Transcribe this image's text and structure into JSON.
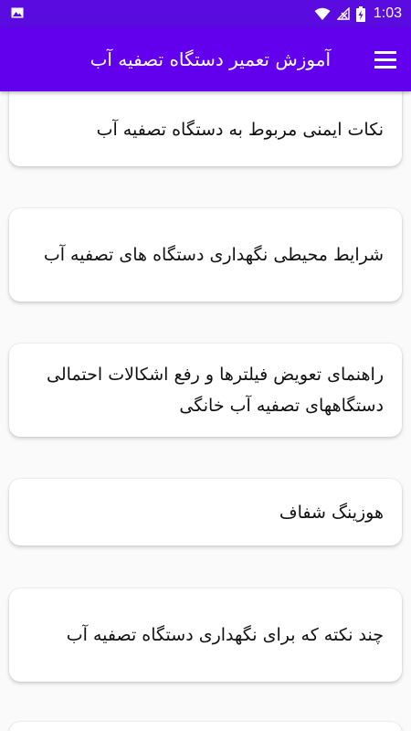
{
  "status_bar": {
    "time": "1:03",
    "icons": [
      "image-icon",
      "wifi-icon",
      "signal-icon",
      "battery-charging-icon"
    ]
  },
  "app_bar": {
    "title": "آموزش تعمیر دستگاه تصفیه آب",
    "menu_icon": "hamburger-menu-icon"
  },
  "colors": {
    "primary": "#6200ee",
    "status_bar": "#5a0be0",
    "background": "#fafafa",
    "card": "#ffffff"
  },
  "items": [
    {
      "label": "نکات ایمنی مربوط به دستگاه تصفیه آب"
    },
    {
      "label": "شرایط محیطی نگهداری دستگاه های تصفیه آب"
    },
    {
      "label": "راهنمای تعویض فیلترها و رفع اشکالات احتمالی دستگاههای تصفیه آب خانگی"
    },
    {
      "label": "هوزینگ شفاف"
    },
    {
      "label": "چند نکته که برای نگهداری دستگاه تصفیه آب"
    }
  ]
}
